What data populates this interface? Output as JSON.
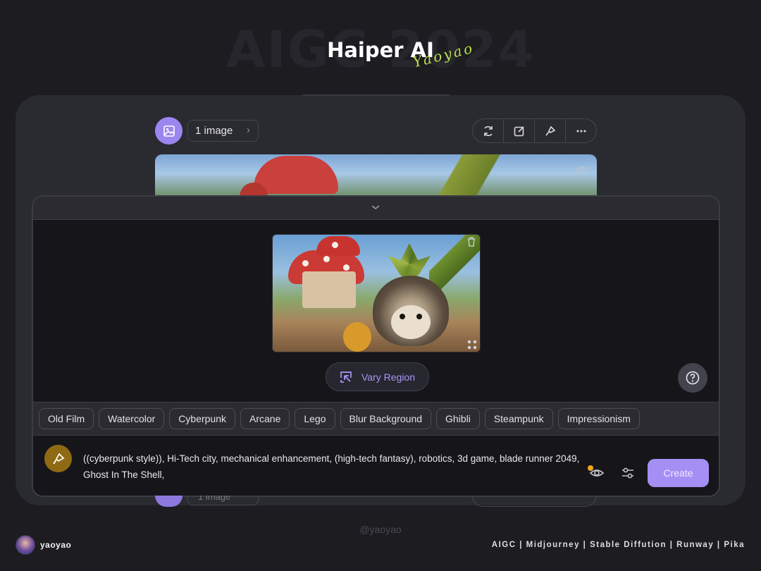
{
  "header": {
    "watermark": "AIGC 2024",
    "title": "Haiper AI",
    "signature": "Yaoyao"
  },
  "result_card": {
    "image_count_label": "1 image",
    "toolbar_icons": [
      "refresh-icon",
      "edit-icon",
      "brush-icon",
      "more-icon"
    ]
  },
  "editor": {
    "vary_region_label": "Vary Region",
    "styles": [
      "Old Film",
      "Watercolor",
      "Cyberpunk",
      "Arcane",
      "Lego",
      "Blur Background",
      "Ghibli",
      "Steampunk",
      "Impressionism"
    ],
    "prompt_line1": "((cyberpunk style)), Hi-Tech city, mechanical enhancement, (high-tech fantasy), robotics, 3d game, blade runner 2049,",
    "prompt_line2": "Ghost In The Shell,",
    "create_label": "Create"
  },
  "ghost_row": {
    "image_count_label": "1 image"
  },
  "footer": {
    "handle": "@yaoyao",
    "username": "yaoyao",
    "tags": "AIGC | Midjourney | Stable Diffution | Runway | Pika"
  },
  "colors": {
    "accent": "#a58ff5",
    "background": "#1c1c21",
    "panel": "#2a2a31",
    "notification_dot": "#f0a71f",
    "signature": "#b8e04a"
  }
}
